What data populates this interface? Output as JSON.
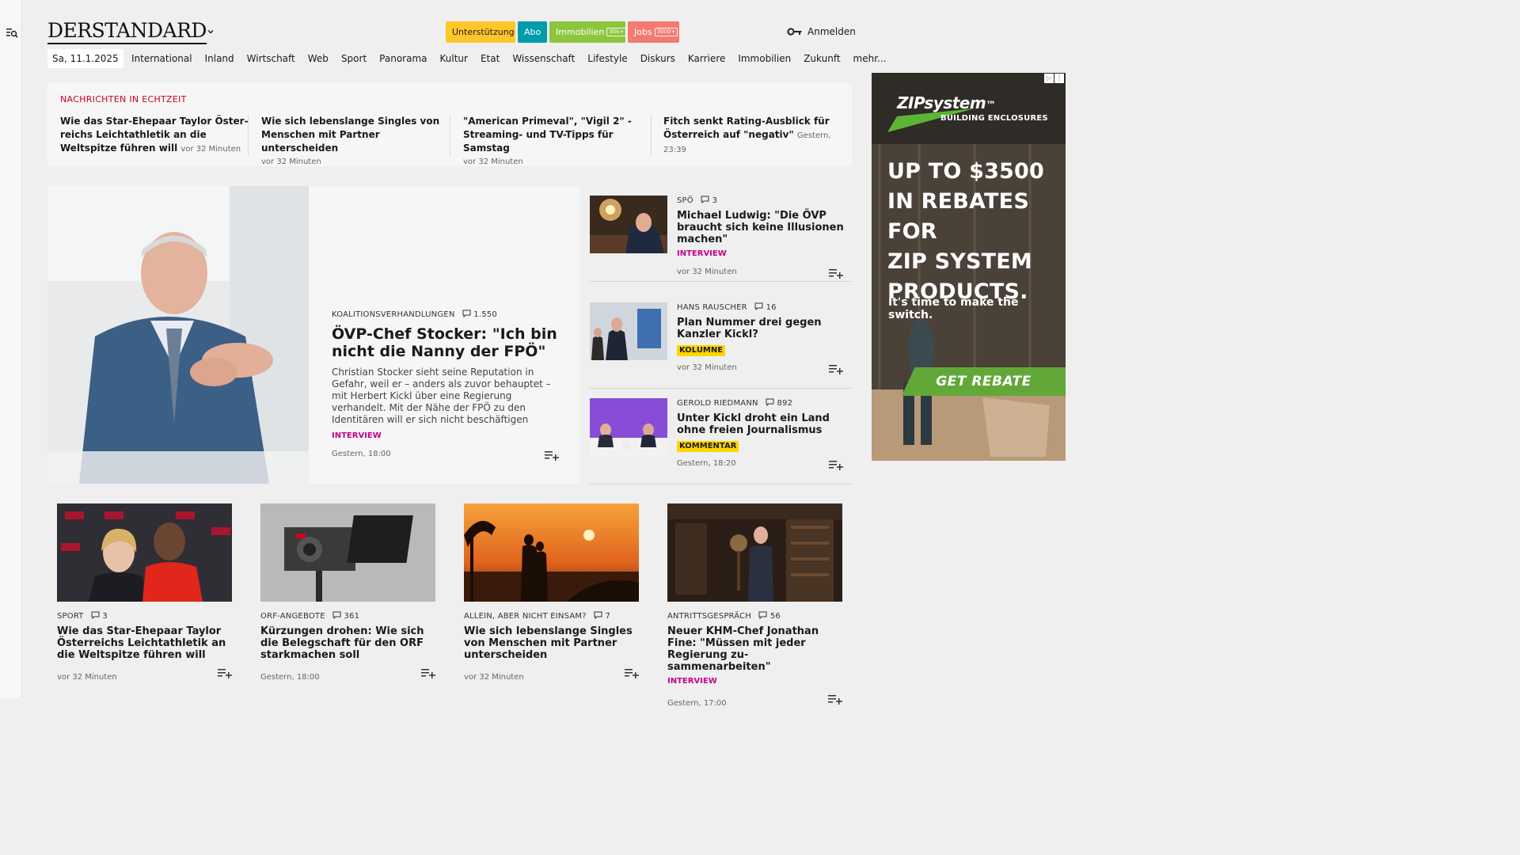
{
  "brand": {
    "logo": "DERSTANDARD"
  },
  "header": {
    "support_label": "Unterstützung",
    "abo_label": "Abo",
    "immobilien_label": "Immobilien",
    "immobilien_tag": "30k+",
    "jobs_label": "Jobs",
    "jobs_tag": "3000+",
    "login_label": "Anmelden"
  },
  "nav": {
    "date": "Sa, 11.1.2025",
    "items": [
      "International",
      "Inland",
      "Wirtschaft",
      "Web",
      "Sport",
      "Panorama",
      "Kultur",
      "Etat",
      "Wissenschaft",
      "Lifestyle",
      "Diskurs",
      "Karriere",
      "Immobilien",
      "Zukunft",
      "mehr..."
    ]
  },
  "realtime": {
    "title": "NACHRICHTEN IN ECHTZEIT",
    "items": [
      {
        "headline": "Wie das Star-Ehepaar Taylor Öster­reichs Leichtathletik an die Weltspitze führen will",
        "time": "vor 32 Minuten"
      },
      {
        "headline": "Wie sich lebenslange Singles von Menschen mit Partner unterscheiden",
        "time": "vor 32 Minuten"
      },
      {
        "headline": "\"American Primeval\", \"Vigil 2\" - Strea­ming- und TV-Tipps für Samstag",
        "time": "vor 32 Minuten"
      },
      {
        "headline": "Fitch senkt Rating-Ausblick für Öster­reich auf \"negativ\"",
        "time": "Gestern, 23:39"
      }
    ]
  },
  "hero": {
    "kicker": "KOALITIONSVERHANDLUNGEN",
    "comments": "1.550",
    "title": "ÖVP-Chef Stocker: \"Ich bin nicht die Nanny der FPÖ\"",
    "lead": "Christian Stocker sieht seine Reputation in Gefahr, weil er – anders als zuvor behauptet – mit Herbert Kickl über eine Regierung verhandelt. Mit der Nähe der FPÖ zu den Identitären will er sich nicht beschäftigen",
    "tag": "INTERVIEW",
    "time": "Gestern, 18:00"
  },
  "side": [
    {
      "kicker": "SPÖ",
      "comments": "3",
      "title": "Michael Ludwig: \"Die ÖVP braucht sich keine Illusionen machen\"",
      "tag": "INTERVIEW",
      "time": "vor 32 Minuten"
    },
    {
      "kicker": "HANS RAUSCHER",
      "comments": "16",
      "title": "Plan Nummer drei gegen Kanzler Kickl?",
      "tag": "KOLUMNE",
      "time": "vor 32 Minuten"
    },
    {
      "kicker": "GEROLD RIEDMANN",
      "comments": "892",
      "title": "Unter Kickl droht ein Land ohne freien Journalismus",
      "tag": "KOMMENTAR",
      "time": "Gestern, 18:20"
    }
  ],
  "cards": [
    {
      "kicker": "SPORT",
      "comments": "3",
      "title": "Wie das Star-Ehepaar Taylor Österreichs Leichtathletik an die Weltspitze führen will",
      "time": "vor 32 Minuten"
    },
    {
      "kicker": "ORF-ANGEBOTE",
      "comments": "361",
      "title": "Kürzungen drohen: Wie sich die Belegschaft für den ORF starkmachen soll",
      "time": "Gestern, 18:00"
    },
    {
      "kicker": "ALLEIN, ABER NICHT EINSAM?",
      "comments": "7",
      "title": "Wie sich lebenslange Singles von Menschen mit Partner unterscheiden",
      "time": "vor 32 Minuten"
    },
    {
      "kicker": "ANTRITTSGESPRÄCH",
      "comments": "56",
      "title": "Neuer KHM-Chef Jonathan Fine: \"Müssen mit jeder Regierung zu­sammenarbeiten\"",
      "tag": "INTERVIEW",
      "time": "Gestern, 17:00"
    }
  ],
  "ad": {
    "brand": "ZIPsystem",
    "brand_tm": "™",
    "sub": "BUILDING ENCLOSURES",
    "headline_1": "UP TO $3500",
    "headline_2": "IN REBATES FOR",
    "headline_3": "ZIP SYSTEM",
    "headline_4": "PRODUCTS.",
    "tagline": "It's time to make the switch.",
    "cta": "GET REBATE"
  },
  "colors": {
    "accent_red": "#d0021b",
    "interview_magenta": "#c4008c",
    "label_yellow": "#ffd600",
    "support": "#ffc629",
    "abo": "#009cab",
    "immobilien": "#8cc63f",
    "jobs": "#f37a71"
  }
}
